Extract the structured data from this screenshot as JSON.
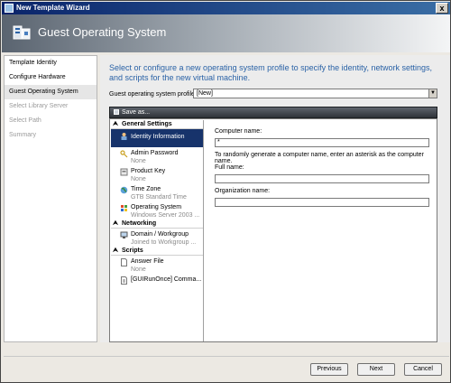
{
  "window": {
    "title": "New Template Wizard",
    "close_glyph": "x"
  },
  "banner": {
    "title": "Guest Operating System"
  },
  "steps": [
    {
      "label": "Template Identity",
      "state": "done"
    },
    {
      "label": "Configure Hardware",
      "state": "done"
    },
    {
      "label": "Guest Operating System",
      "state": "active"
    },
    {
      "label": "Select Library Server",
      "state": "disabled"
    },
    {
      "label": "Select Path",
      "state": "disabled"
    },
    {
      "label": "Summary",
      "state": "disabled"
    }
  ],
  "main": {
    "intro": "Select or configure a new operating system profile to specify the identity, network settings, and scripts for the new virtual machine.",
    "profile_label": "Guest operating system profile:",
    "profile_value": "[New]",
    "save_as": "Save as..."
  },
  "tree": {
    "general_settings": "General Settings",
    "identity": "Identity Information",
    "admin_password": {
      "name": "Admin Password",
      "sub": "None"
    },
    "product_key": {
      "name": "Product Key",
      "sub": "None"
    },
    "time_zone": {
      "name": "Time Zone",
      "sub": "GTB Standard Time"
    },
    "operating_system": {
      "name": "Operating System",
      "sub": "Windows Server 2003 ..."
    },
    "networking": "Networking",
    "domain": {
      "name": "Domain / Workgroup",
      "sub": "Joined to Workgroup ..."
    },
    "scripts": "Scripts",
    "answer_file": {
      "name": "Answer File",
      "sub": "None"
    },
    "guirunonce": {
      "name": "[GUIRunOnce] Comma..."
    }
  },
  "detail": {
    "computer_name_label": "Computer name:",
    "computer_name_value": "*",
    "computer_name_hint": "To randomly generate a computer name, enter an asterisk as the computer name.",
    "full_name_label": "Full name:",
    "full_name_value": "",
    "org_name_label": "Organization name:",
    "org_name_value": ""
  },
  "buttons": {
    "previous": "Previous",
    "next": "Next",
    "cancel": "Cancel"
  },
  "colors": {
    "intro_text": "#2a62a6",
    "selected_node": "#17336b"
  }
}
